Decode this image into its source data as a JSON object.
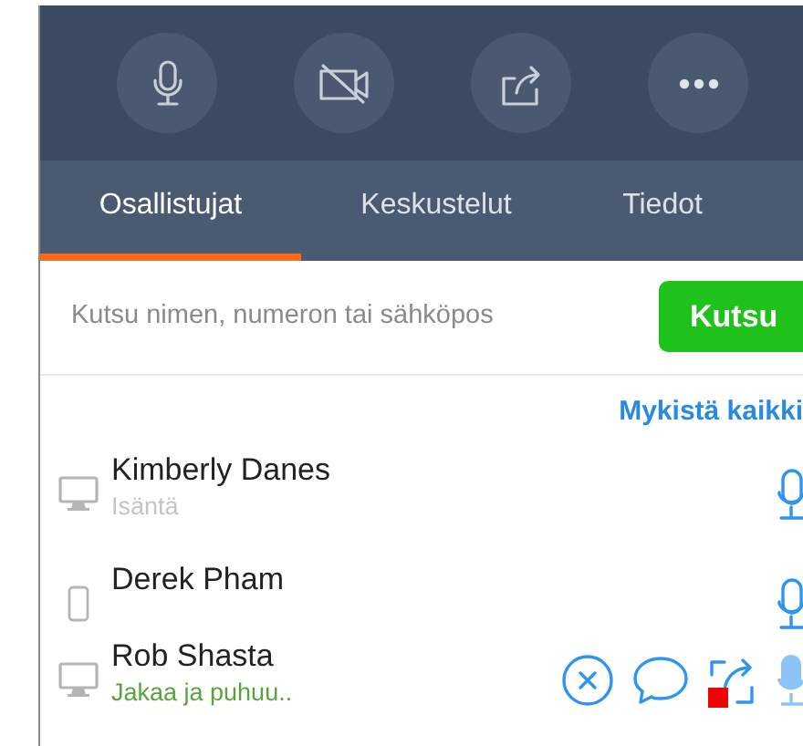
{
  "toolbar": [
    {
      "kind": "microphone"
    },
    {
      "kind": "video_off"
    },
    {
      "kind": "share"
    },
    {
      "kind": "more"
    }
  ],
  "tabs": [
    {
      "label": "Osallistujat",
      "selected": true
    },
    {
      "label": "Keskustelut",
      "selected": false
    },
    {
      "label": "Tiedot",
      "selected": false
    }
  ],
  "invite": {
    "placeholder": "Kutsu nimen, numeron tai sähköpos",
    "button": "Kutsu"
  },
  "mute_all": "Mykistä kaikki",
  "participants": [
    {
      "name": "Kimberly Danes",
      "device": {
        "kind": "desktop"
      },
      "status": {
        "text": "Isäntä",
        "kind": "role"
      },
      "speaking": false
    },
    {
      "name": "Derek Pham",
      "device": {
        "kind": "phone"
      },
      "speaking": false
    },
    {
      "name": "Rob Shasta",
      "device": {
        "kind": "desktop"
      },
      "status": {
        "text": "Jakaa ja puhuu..",
        "kind": "activity"
      },
      "speaking": true,
      "actions": [
        {
          "kind": "remove"
        },
        {
          "kind": "chat"
        },
        {
          "kind": "share"
        }
      ]
    }
  ]
}
